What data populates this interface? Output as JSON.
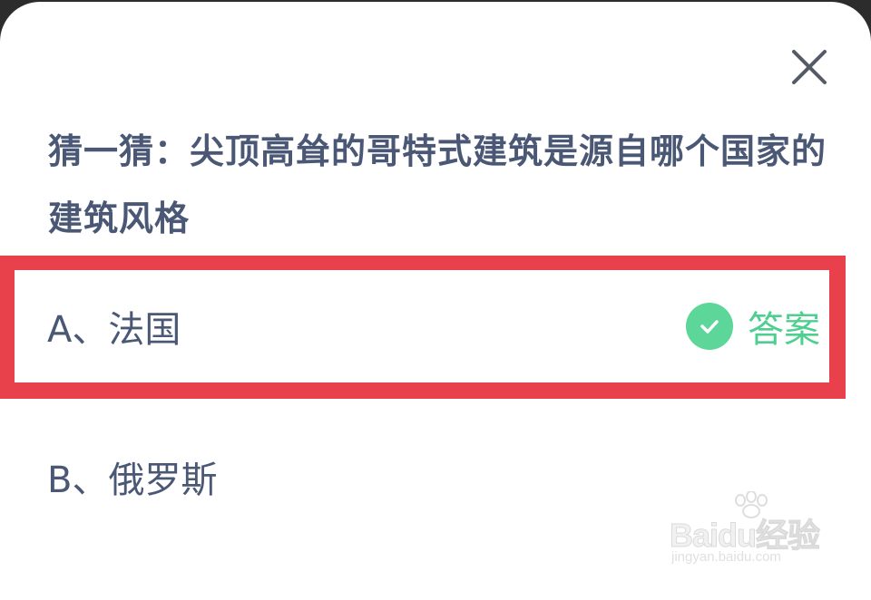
{
  "quiz": {
    "question": "猜一猜：尖顶高耸的哥特式建筑是源自哪个国家的建筑风格",
    "options": [
      {
        "label": "A、法国",
        "is_answer": true,
        "answer_badge": "答案"
      },
      {
        "label": "B、俄罗斯",
        "is_answer": false
      }
    ]
  },
  "icons": {
    "close": "close-icon",
    "check": "check-circle-icon"
  },
  "watermark": {
    "brand": "Baidu经验",
    "url": "jingyan.baidu.com"
  },
  "colors": {
    "question_text": "#4a5875",
    "highlight_border": "#e9414b",
    "answer_green": "#4fcf8f",
    "check_bg": "#5dd69a"
  }
}
